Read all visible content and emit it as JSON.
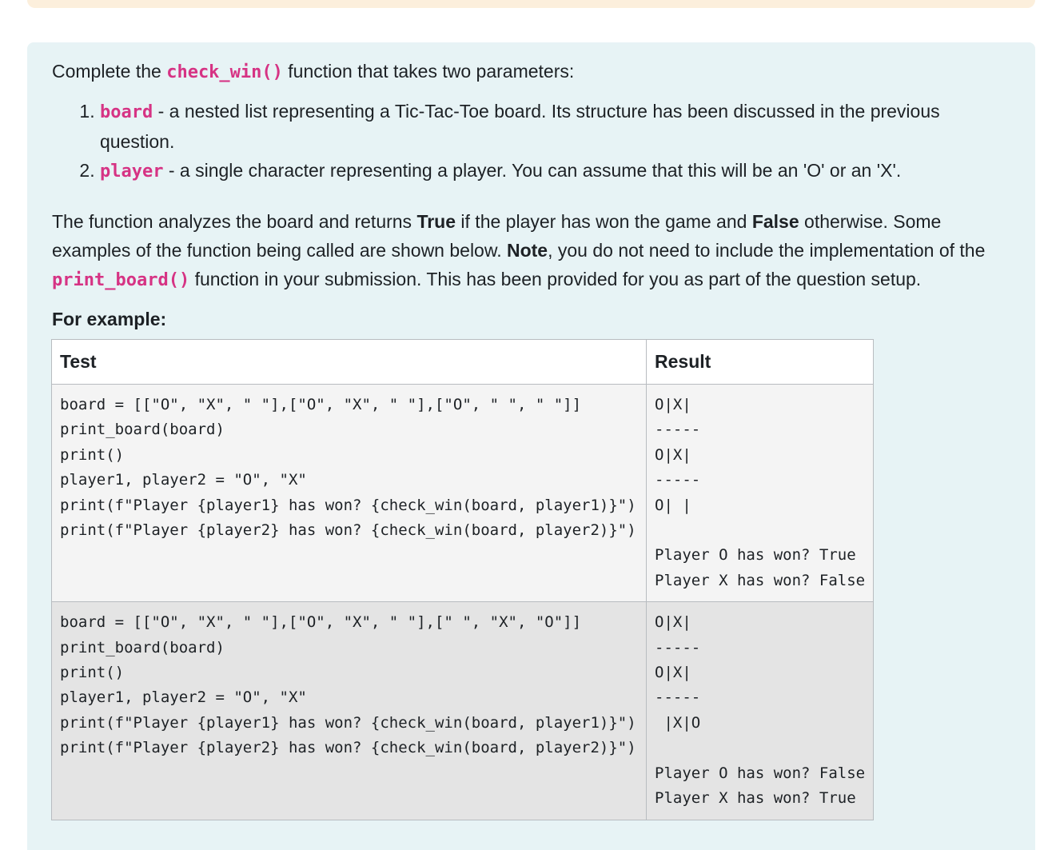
{
  "intro": {
    "prefix": "Complete the ",
    "func_name": "check_win()",
    "suffix": " function that takes two parameters:"
  },
  "params": [
    {
      "name": "board",
      "desc": " - a nested list representing a Tic-Tac-Toe board. Its structure has been discussed in the previous question."
    },
    {
      "name": "player",
      "desc": " - a single character representing a player. You can assume that this will be an 'O' or an 'X'."
    }
  ],
  "description": {
    "part1": "The function analyzes the board and returns ",
    "true_word": "True",
    "part2": " if the player has won the game and ",
    "false_word": "False",
    "part3": " otherwise. Some examples of the function being called are shown below. ",
    "note_word": "Note",
    "part4": ", you do not need to include the implementation of the ",
    "func_name": "print_board()",
    "part5": " function in your submission. This has been provided for you as part of the question setup."
  },
  "for_example_label": "For example:",
  "table": {
    "headers": [
      "Test",
      "Result"
    ],
    "rows": [
      {
        "test": "board = [[\"O\", \"X\", \" \"],[\"O\", \"X\", \" \"],[\"O\", \" \", \" \"]]\nprint_board(board)\nprint()\nplayer1, player2 = \"O\", \"X\"\nprint(f\"Player {player1} has won? {check_win(board, player1)}\")\nprint(f\"Player {player2} has won? {check_win(board, player2)}\")",
        "result": "O|X|\n-----\nO|X|\n-----\nO| |\n\nPlayer O has won? True\nPlayer X has won? False"
      },
      {
        "test": "board = [[\"O\", \"X\", \" \"],[\"O\", \"X\", \" \"],[\" \", \"X\", \"O\"]]\nprint_board(board)\nprint()\nplayer1, player2 = \"O\", \"X\"\nprint(f\"Player {player1} has won? {check_win(board, player1)}\")\nprint(f\"Player {player2} has won? {check_win(board, player2)}\")",
        "result": "O|X|\n-----\nO|X|\n-----\n |X|O\n\nPlayer O has won? False\nPlayer X has won? True"
      }
    ]
  }
}
